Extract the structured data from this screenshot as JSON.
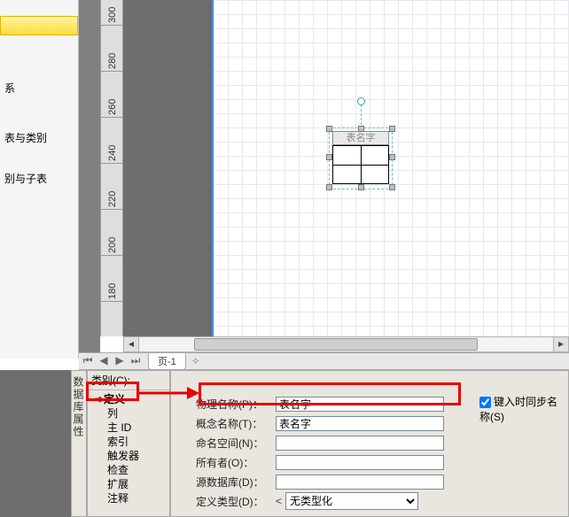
{
  "sidebar": {
    "items": [
      {
        "label": ""
      },
      {
        "label": "系"
      },
      {
        "label": "表与类别"
      },
      {
        "label": "别与子表"
      }
    ]
  },
  "ruler": {
    "ticks": [
      300,
      280,
      260,
      240,
      220,
      200,
      180
    ]
  },
  "canvas": {
    "shape_title": "表名字"
  },
  "tabs": {
    "page_label": "页-1"
  },
  "panel": {
    "vertical_title": "数据库属性",
    "categories_header": "类别(C):",
    "tree": [
      {
        "label": "定义",
        "indent": false,
        "selected": true,
        "arrow": true
      },
      {
        "label": "列",
        "indent": true
      },
      {
        "label": "主 ID",
        "indent": true
      },
      {
        "label": "索引",
        "indent": true
      },
      {
        "label": "触发器",
        "indent": true
      },
      {
        "label": "检查",
        "indent": true
      },
      {
        "label": "扩展",
        "indent": true
      },
      {
        "label": "注释",
        "indent": true
      }
    ]
  },
  "form": {
    "physical_label": "物理名称(P)：",
    "physical_value": "表名字",
    "concept_label": "概念名称(T)：",
    "concept_value": "表名字",
    "namespace_label": "命名空间(N)：",
    "namespace_value": "",
    "owner_label": "所有者(O)：",
    "owner_value": "",
    "source_label": "源数据库(D)：",
    "source_value": "",
    "deftype_label": "定义类型(D)：",
    "deftype_value": "无类型化",
    "sync_label": "键入时同步名称(S)"
  }
}
